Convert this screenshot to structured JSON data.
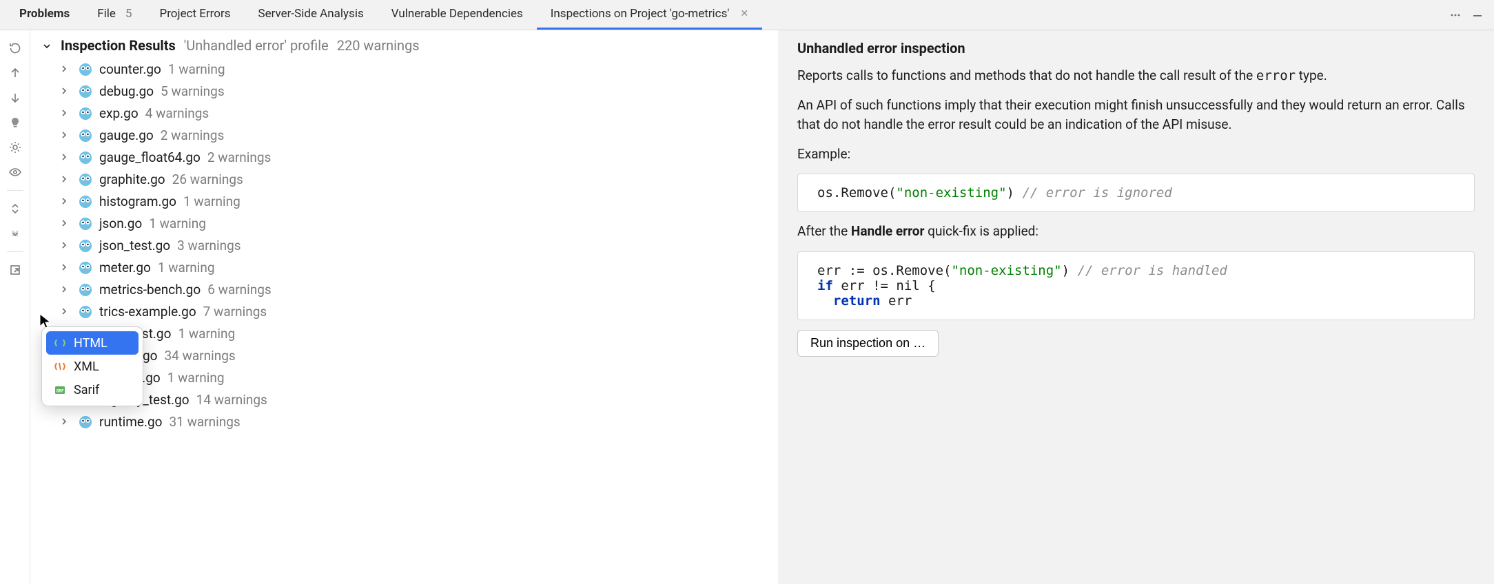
{
  "tabs": {
    "problems": "Problems",
    "file": "File",
    "file_count": "5",
    "project_errors": "Project Errors",
    "server_side": "Server-Side Analysis",
    "vuln_deps": "Vulnerable Dependencies",
    "inspections": "Inspections on Project 'go-metrics'"
  },
  "tree": {
    "title": "Inspection Results",
    "subtitle": "'Unhandled error' profile",
    "count": "220 warnings",
    "files": [
      {
        "name": "counter.go",
        "count": "1 warning"
      },
      {
        "name": "debug.go",
        "count": "5 warnings"
      },
      {
        "name": "exp.go",
        "count": "4 warnings"
      },
      {
        "name": "gauge.go",
        "count": "2 warnings"
      },
      {
        "name": "gauge_float64.go",
        "count": "2 warnings"
      },
      {
        "name": "graphite.go",
        "count": "26 warnings"
      },
      {
        "name": "histogram.go",
        "count": "1 warning"
      },
      {
        "name": "json.go",
        "count": "1 warning"
      },
      {
        "name": "json_test.go",
        "count": "3 warnings"
      },
      {
        "name": "meter.go",
        "count": "1 warning"
      },
      {
        "name": "metrics-bench.go",
        "count": "6 warnings"
      },
      {
        "name": "trics-example.go",
        "count": "7 warnings"
      },
      {
        "name": "trics_test.go",
        "count": "1 warning"
      },
      {
        "name": "entsdb.go",
        "count": "34 warnings"
      },
      {
        "name": "registry.go",
        "count": "1 warning"
      },
      {
        "name": "registry_test.go",
        "count": "14 warnings"
      },
      {
        "name": "runtime.go",
        "count": "31 warnings"
      }
    ]
  },
  "popup": {
    "html": "HTML",
    "xml": "XML",
    "sarif": "Sarif"
  },
  "detail": {
    "heading": "Unhandled error inspection",
    "p1a": "Reports calls to functions and methods that do not handle the call result of the ",
    "p1_code": "error",
    "p1b": " type.",
    "p2": "An API of such functions imply that their execution might finish unsuccessfully and they would return an error. Calls that do not handle the error result could be an indication of the API misuse.",
    "example_label": "Example:",
    "code1_pre": "os.Remove(",
    "code1_str": "\"non-existing\"",
    "code1_post": ") ",
    "code1_cmt": "// error is ignored",
    "after_a": "After the ",
    "after_b": "Handle error",
    "after_c": " quick-fix is applied:",
    "code2_l1a": "err := os.Remove(",
    "code2_l1b": "\"non-existing\"",
    "code2_l1c": ") ",
    "code2_l1d": "// error is handled",
    "code2_l2a": "if",
    "code2_l2b": " err != nil {",
    "code2_l3a": "  ",
    "code2_l3b": "return",
    "code2_l3c": " err",
    "run_button": "Run inspection on …"
  }
}
